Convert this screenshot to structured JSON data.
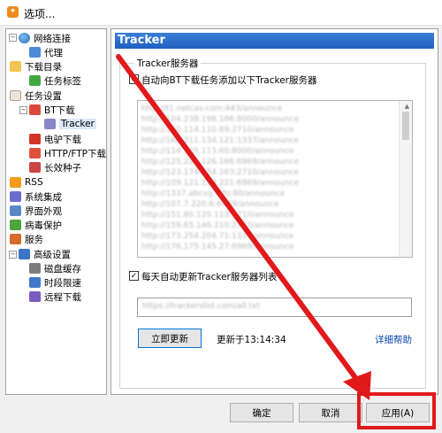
{
  "window": {
    "title": "选项..."
  },
  "tree": {
    "items": [
      {
        "label": "网络连接",
        "icon": "globe-icon"
      },
      {
        "label": "代理",
        "icon": "proxy-icon"
      },
      {
        "label": "下载目录",
        "icon": "folder-icon"
      },
      {
        "label": "任务标签",
        "icon": "tag-icon"
      },
      {
        "label": "任务设置",
        "icon": "task-settings-icon"
      },
      {
        "label": "BT下载",
        "icon": "bt-icon"
      },
      {
        "label": "Tracker",
        "icon": "tracker-icon"
      },
      {
        "label": "电驴下载",
        "icon": "emule-icon"
      },
      {
        "label": "HTTP/FTP下载",
        "icon": "http-ftp-icon"
      },
      {
        "label": "长效种子",
        "icon": "seed-icon"
      },
      {
        "label": "RSS",
        "icon": "rss-icon"
      },
      {
        "label": "系统集成",
        "icon": "integration-icon"
      },
      {
        "label": "界面外观",
        "icon": "appearance-icon"
      },
      {
        "label": "病毒保护",
        "icon": "virus-protect-icon"
      },
      {
        "label": "服务",
        "icon": "service-icon"
      },
      {
        "label": "高级设置",
        "icon": "advanced-icon"
      },
      {
        "label": "磁盘缓存",
        "icon": "disk-cache-icon"
      },
      {
        "label": "时段限速",
        "icon": "speed-limit-icon"
      },
      {
        "label": "远程下载",
        "icon": "remote-icon"
      }
    ]
  },
  "panel": {
    "header": "Tracker",
    "group_title": "Tracker服务器",
    "auto_add_label": "自动向BT下载任务添加以下Tracker服务器",
    "tracker_lines": [
      "http://t1.netcav.com:443/announce",
      "http://104.238.198.186:8000/announce",
      "http://150.114.110.69:2710/announce",
      "http://162.211.134.121:1337/announce",
      "http://114.255.113.60:8000/announce",
      "http://125.222.126.166:6969/announce",
      "http://123.174.154.163:2710/announce",
      "http://109.121.134.221:6969/announce",
      "http://1337.abcvg.info:80/announce",
      "http://107.7.220.6:6969/announce",
      "http://151.80.120.113:2710/announce",
      "http://159.65.146.210:2710/announce",
      "http://173.254.204.71:1337/announce",
      "http://176.175.145.27:6969/announce"
    ],
    "daily_update_label": "每天自动更新Tracker服务器列表",
    "update_url": "https://trackerslist.com/all.txt",
    "update_now_button": "立即更新",
    "updated_at": "更新于13:14:34",
    "help_link": "详细帮助"
  },
  "footer": {
    "ok_button": "确定",
    "cancel_button": "取消",
    "apply_button": "应用(A)"
  },
  "colors": {
    "annotation": "#e0191b",
    "header_blue": "#1f5fbf"
  }
}
